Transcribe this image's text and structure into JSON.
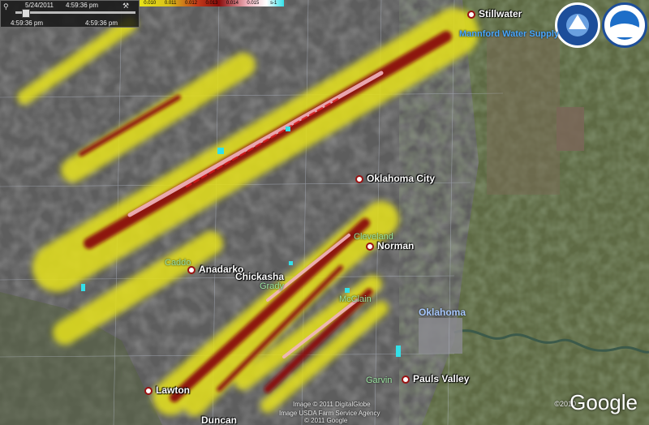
{
  "timebar": {
    "date": "5/24/2011",
    "time_top": "4:59:36 pm",
    "start_label": "4:59:36 pm",
    "end_label": "4:59:36 pm"
  },
  "scale": [
    "0.010",
    "0.011",
    "0.012",
    "0.013",
    "0.014",
    "0.015",
    "s-1"
  ],
  "cities": [
    {
      "name": "Stillwater"
    },
    {
      "name": "Oklahoma City"
    },
    {
      "name": "Norman"
    },
    {
      "name": "Anadarko"
    },
    {
      "name": "Chickasha"
    },
    {
      "name": "Lawton"
    },
    {
      "name": "Pauls Valley"
    },
    {
      "name": "Duncan"
    }
  ],
  "counties": [
    "Cleveland",
    "Caddo",
    "Grady",
    "McClain",
    "Garvin"
  ],
  "state_label": "Oklahoma",
  "poi": "Mannford Water Supply",
  "credits": [
    "Image © 2011 DigitalGlobe",
    "Image USDA Farm Service Agency",
    "© 2011 Google"
  ],
  "google": {
    "brand": "Google",
    "year": "©2010"
  },
  "colors": {
    "yellow": "#e6e21a",
    "darkred": "#8a0c0c",
    "red": "#d21a1a",
    "pink": "#f2b5c0",
    "cyan": "#34e0e8",
    "gray": "#5b5b5b"
  }
}
